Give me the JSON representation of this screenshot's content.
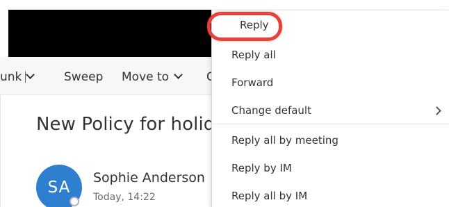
{
  "toolbar": {
    "junk_label": "unk",
    "sweep_label": "Sweep",
    "move_to_label": "Move to",
    "more_label": "C"
  },
  "message": {
    "subject": "New Policy for holid",
    "sender_name": "Sophie Anderson",
    "sender_initials": "SA",
    "timestamp": "Today, 14:22"
  },
  "reply_menu": {
    "items": [
      {
        "label": "Reply",
        "highlighted": true
      },
      {
        "label": "Reply all"
      },
      {
        "label": "Forward"
      },
      {
        "label": "Change default",
        "submenu_icon": "chevron-right-icon"
      },
      {
        "label": "Reply all by meeting"
      },
      {
        "label": "Reply by IM"
      },
      {
        "label": "Reply all by IM"
      }
    ]
  },
  "colors": {
    "highlight_ring": "#e8413c",
    "avatar_bg": "#2f7fd1"
  }
}
